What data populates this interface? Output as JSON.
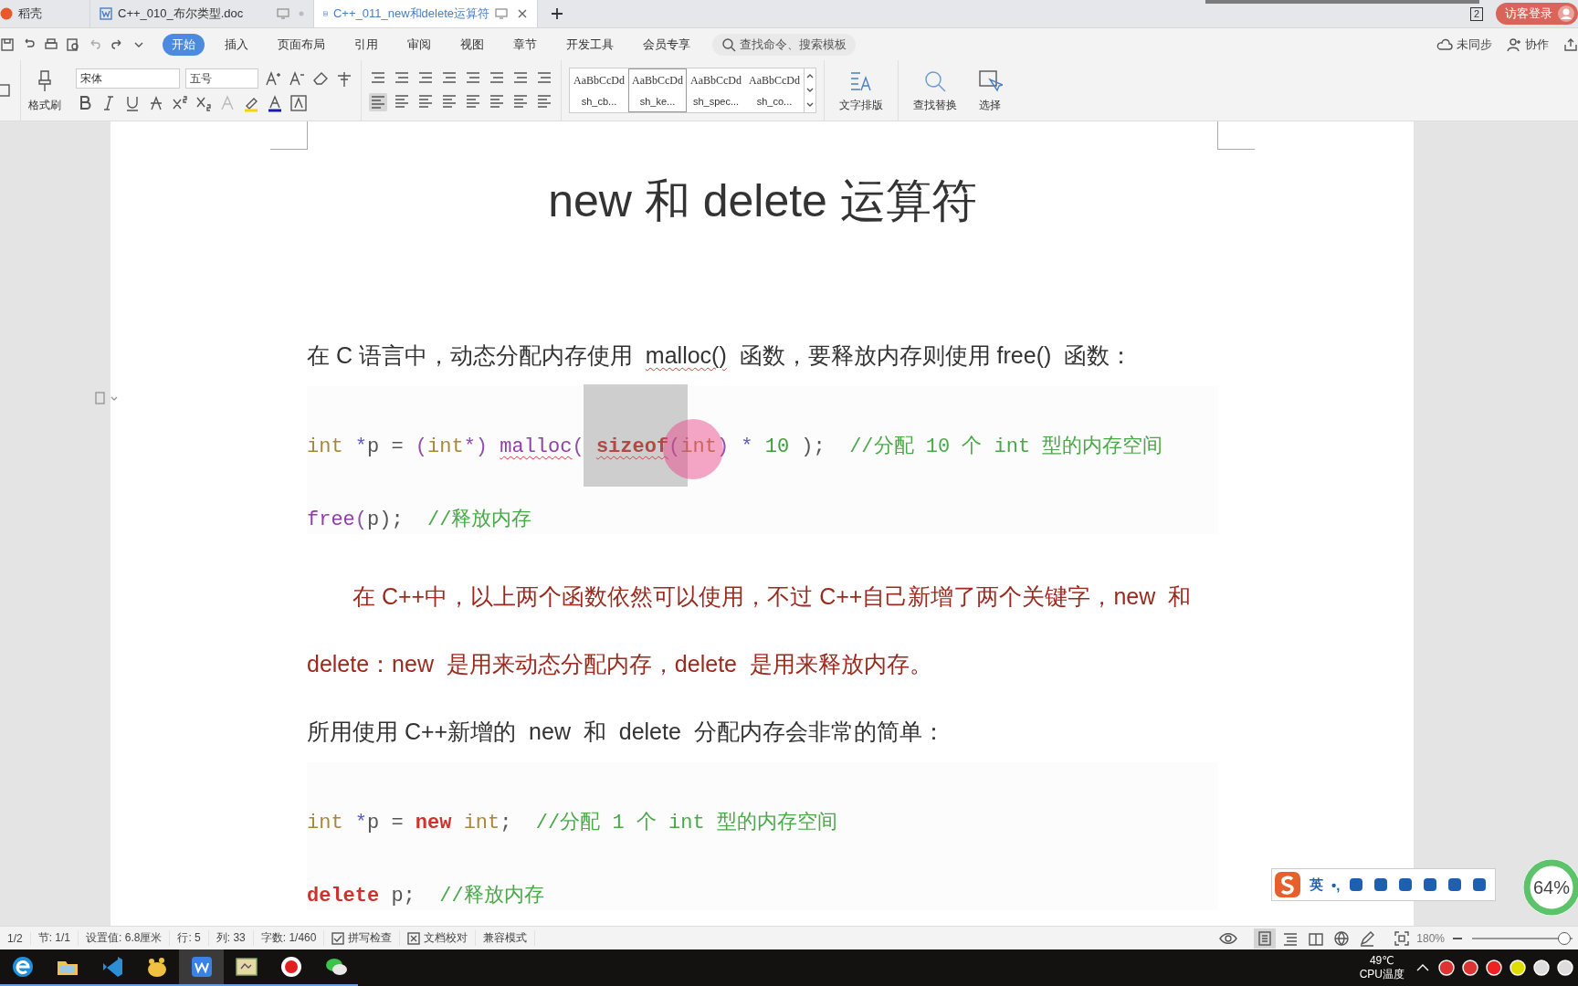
{
  "tabs": [
    {
      "label": "稻壳",
      "kind": "home",
      "selected": false
    },
    {
      "label": "C++_010_布尔类型.doc",
      "kind": "doc",
      "selected": false
    },
    {
      "label": "C++_011_new和delete运算符",
      "kind": "doc",
      "selected": true
    }
  ],
  "window_count": "2",
  "login_button": "访客登录",
  "menu": [
    {
      "label": "开始",
      "selected": true
    },
    {
      "label": "插入",
      "selected": false
    },
    {
      "label": "页面布局",
      "selected": false
    },
    {
      "label": "引用",
      "selected": false
    },
    {
      "label": "审阅",
      "selected": false
    },
    {
      "label": "视图",
      "selected": false
    },
    {
      "label": "章节",
      "selected": false
    },
    {
      "label": "开发工具",
      "selected": false
    },
    {
      "label": "会员专享",
      "selected": false
    }
  ],
  "command_search": {
    "placeholder": "查找命令、搜索模板"
  },
  "account": [
    {
      "label": "未同步",
      "kind": "cloud"
    },
    {
      "label": "协作",
      "kind": "people"
    }
  ],
  "ribbon": {
    "format_painter": "格式刷",
    "font_name": "宋体",
    "font_size": "五号",
    "styles": [
      {
        "preview": "AaBbCcDd",
        "label": "sh_cb...",
        "selected": false
      },
      {
        "preview": "AaBbCcDd",
        "label": "sh_ke...",
        "selected": true
      },
      {
        "preview": "AaBbCcDd",
        "label": "sh_spec...",
        "selected": false
      },
      {
        "preview": "AaBbCcDd",
        "label": "sh_co...",
        "selected": false
      }
    ],
    "text_layout": "文字排版",
    "find_replace": "查找替换",
    "select": "选择"
  },
  "document": {
    "title": "new 和 delete 运算符",
    "blocks": [
      {
        "kind": "paragraph",
        "segments": [
          {
            "text": "在 C 语言中，动态分配内存使用  ",
            "flagged": false
          },
          {
            "text": "malloc()",
            "flagged": true
          },
          {
            "text": "  函数，要释放内存则使用 free()  函数：",
            "flagged": false
          }
        ]
      },
      {
        "kind": "code",
        "lines": [
          [
            {
              "text": "int",
              "kind": "type",
              "flagged": false
            },
            {
              "text": " *",
              "kind": "op",
              "flagged": false
            },
            {
              "text": "p = ",
              "kind": "plain",
              "flagged": false
            },
            {
              "text": "(",
              "kind": "paren",
              "flagged": false
            },
            {
              "text": "int",
              "kind": "type",
              "flagged": false
            },
            {
              "text": "*) ",
              "kind": "paren",
              "flagged": false
            },
            {
              "text": "malloc",
              "kind": "func",
              "flagged": true
            },
            {
              "text": "( ",
              "kind": "paren",
              "flagged": false
            },
            {
              "text": "sizeof",
              "kind": "keyword",
              "flagged": true
            },
            {
              "text": "(",
              "kind": "paren",
              "flagged": false
            },
            {
              "text": "int",
              "kind": "type",
              "flagged": false
            },
            {
              "text": ")",
              "kind": "paren",
              "flagged": false
            },
            {
              "text": " * ",
              "kind": "op",
              "flagged": false
            },
            {
              "text": "10",
              "kind": "number",
              "flagged": false
            },
            {
              "text": " );  ",
              "kind": "plain",
              "flagged": false
            },
            {
              "text": "//分配 10 个 int 型的内存空间",
              "kind": "comment",
              "flagged": false
            }
          ],
          [
            {
              "text": "free",
              "kind": "func",
              "flagged": false
            },
            {
              "text": "(",
              "kind": "paren",
              "flagged": false
            },
            {
              "text": "p",
              "kind": "plain",
              "flagged": false
            },
            {
              "text": ");  ",
              "kind": "plain",
              "flagged": false
            },
            {
              "text": "//释放内存",
              "kind": "comment",
              "flagged": false
            }
          ]
        ]
      },
      {
        "kind": "note",
        "lines": [
          "在 C++中，以上两个函数依然可以使用，不过 C++自己新增了两个关键字，new  和",
          "delete：new  是用来动态分配内存，delete  是用来释放内存。"
        ]
      },
      {
        "kind": "paragraph",
        "segments": [
          {
            "text": "所用使用 C++新增的  new  和  delete  分配内存会非常的简单：",
            "flagged": false
          }
        ]
      },
      {
        "kind": "code",
        "lines": [
          [
            {
              "text": "int",
              "kind": "type",
              "flagged": false
            },
            {
              "text": " *",
              "kind": "op",
              "flagged": false
            },
            {
              "text": "p = ",
              "kind": "plain",
              "flagged": false
            },
            {
              "text": "new",
              "kind": "keyword",
              "flagged": false
            },
            {
              "text": " int",
              "kind": "type",
              "flagged": false
            },
            {
              "text": ";  ",
              "kind": "plain",
              "flagged": false
            },
            {
              "text": "//分配 1 个 int 型的内存空间",
              "kind": "comment",
              "flagged": false
            }
          ],
          [
            {
              "text": "delete",
              "kind": "keyword",
              "flagged": false
            },
            {
              "text": " p;  ",
              "kind": "plain",
              "flagged": false
            },
            {
              "text": "//释放内存",
              "kind": "comment",
              "flagged": false
            }
          ]
        ]
      }
    ]
  },
  "status_bar": {
    "items": [
      "1/2",
      "节: 1/1",
      "设置值: 6.8厘米",
      "行: 5",
      "列: 33",
      "字数: 1/460"
    ],
    "checks": [
      "拼写检查",
      "文档校对"
    ],
    "mode": "兼容模式",
    "view_modes": [
      {
        "kind": "page",
        "selected": true
      },
      {
        "kind": "outline",
        "selected": false
      },
      {
        "kind": "reading",
        "selected": false
      },
      {
        "kind": "web",
        "selected": false
      },
      {
        "kind": "pen",
        "selected": false
      }
    ],
    "zoom": "180%",
    "zoom_slider": {
      "level": 0.92
    }
  },
  "taskbar": {
    "apps": [
      {
        "kind": "browser",
        "selected": false
      },
      {
        "kind": "folder",
        "selected": false
      },
      {
        "kind": "code",
        "selected": false
      },
      {
        "kind": "paw",
        "selected": false
      },
      {
        "kind": "wps",
        "selected": true
      },
      {
        "kind": "image",
        "selected": false
      },
      {
        "kind": "record",
        "selected": false
      },
      {
        "kind": "chat",
        "selected": false
      }
    ],
    "temperature": "49℃",
    "temperature_label": "CPU温度"
  },
  "ime": {
    "mode": "英",
    "punctuation": "•,"
  },
  "score_widget": {
    "text": "64%"
  }
}
